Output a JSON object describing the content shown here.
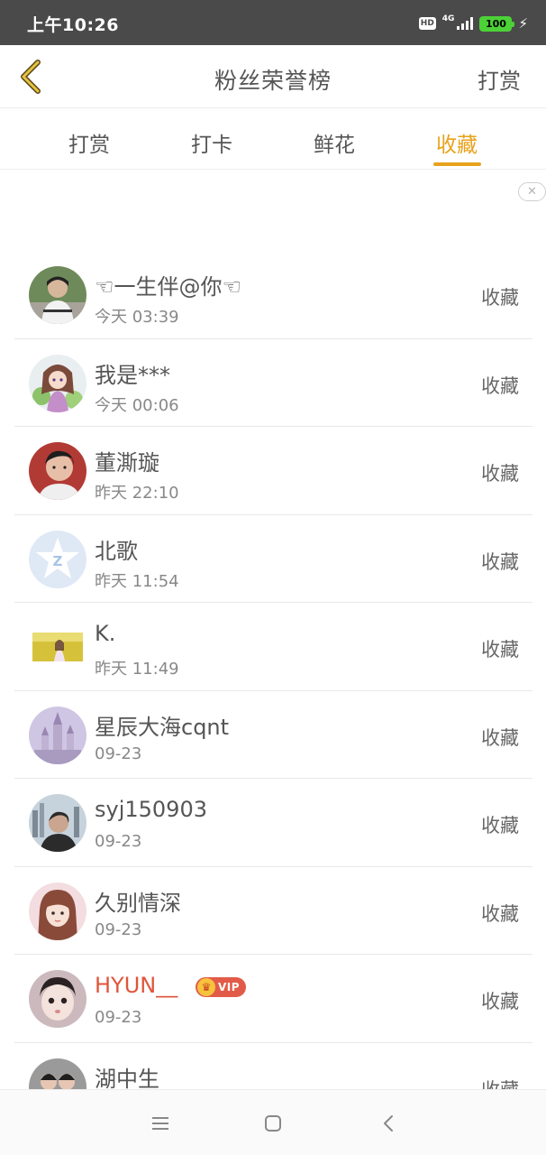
{
  "status_bar": {
    "time": "上午10:26",
    "hd": "HD",
    "network": "4G",
    "battery": "100"
  },
  "nav": {
    "title": "粉丝荣誉榜",
    "action": "打赏"
  },
  "tabs": [
    {
      "label": "打赏"
    },
    {
      "label": "打卡"
    },
    {
      "label": "鲜花"
    },
    {
      "label": "收藏"
    }
  ],
  "active_tab": "收藏",
  "colors": {
    "accent": "#e8a21c",
    "vip_name": "#e0553a",
    "status_bar": "#4a4a4a"
  },
  "list": {
    "items": [
      {
        "name": "☜一生伴@你☜",
        "time": "今天 03:39",
        "action": "收藏",
        "avatar": "boy-photo-avatar"
      },
      {
        "name": "我是***",
        "time": "今天 00:06",
        "action": "收藏",
        "avatar": "anime-girl-avatar"
      },
      {
        "name": "董澌璇",
        "time": "昨天 22:10",
        "action": "收藏",
        "avatar": "man-portrait-avatar"
      },
      {
        "name": "北歌",
        "time": "昨天 11:54",
        "action": "收藏",
        "avatar": "default-star-avatar"
      },
      {
        "name": "K.",
        "time": "昨天 11:49",
        "action": "收藏",
        "avatar": "field-photo-avatar"
      },
      {
        "name": "星辰大海cqnt",
        "time": "09-23",
        "action": "收藏",
        "avatar": "castle-avatar"
      },
      {
        "name": "syj150903",
        "time": "09-23",
        "action": "收藏",
        "avatar": "city-selfie-avatar"
      },
      {
        "name": "久别情深",
        "time": "09-23",
        "action": "收藏",
        "avatar": "girl-portrait-avatar"
      },
      {
        "name": "HYUN__",
        "time": "09-23",
        "action": "收藏",
        "avatar": "baby-avatar",
        "vip": "VIP"
      },
      {
        "name": "湖中生",
        "time": "",
        "action": "收藏",
        "avatar": "group-photo-avatar"
      }
    ]
  },
  "bottom_nav": {
    "icons": [
      "menu-icon",
      "home-square-icon",
      "back-chevron-icon"
    ]
  }
}
